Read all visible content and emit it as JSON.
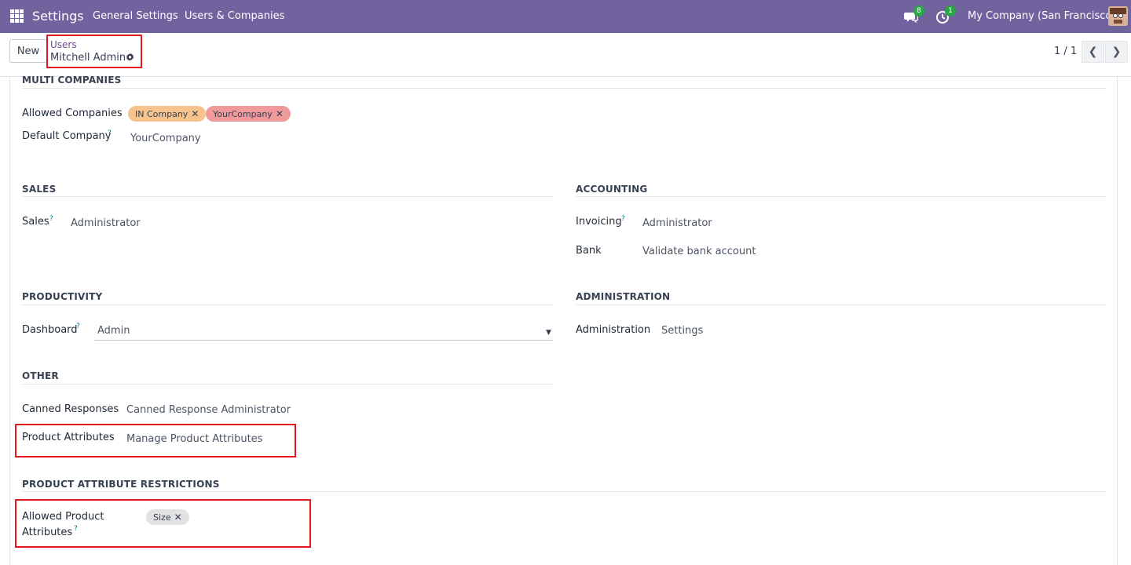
{
  "navbar": {
    "brand": "Settings",
    "menu": [
      "General Settings",
      "Users & Companies"
    ],
    "chat_count": "8",
    "activity_count": "1",
    "company": "My Company (San Francisco)",
    "color": "#71639e"
  },
  "control_panel": {
    "new_label": "New",
    "breadcrumb_parent": "Users",
    "breadcrumb_current": "Mitchell Admin",
    "pager": "1 / 1"
  },
  "form": {
    "multi_companies": {
      "title": "MULTI COMPANIES",
      "allowed_companies_label": "Allowed Companies",
      "allowed_companies_tags": [
        "IN Company",
        "YourCompany"
      ],
      "default_company_label": "Default Company",
      "default_company_value": "YourCompany"
    },
    "sales": {
      "title": "SALES",
      "sales_label": "Sales",
      "sales_value": "Administrator"
    },
    "accounting": {
      "title": "ACCOUNTING",
      "invoicing_label": "Invoicing",
      "invoicing_value": "Administrator",
      "bank_label": "Bank",
      "bank_value": "Validate bank account"
    },
    "productivity": {
      "title": "PRODUCTIVITY",
      "dashboard_label": "Dashboard",
      "dashboard_value": "Admin"
    },
    "administration": {
      "title": "ADMINISTRATION",
      "administration_label": "Administration",
      "administration_value": "Settings"
    },
    "other": {
      "title": "OTHER",
      "canned_label": "Canned Responses",
      "canned_value": "Canned Response Administrator",
      "product_attr_label": "Product Attributes",
      "product_attr_value": "Manage Product Attributes"
    },
    "restrictions": {
      "title": "PRODUCT ATTRIBUTE RESTRICTIONS",
      "allowed_label_line1": "Allowed Product",
      "allowed_label_line2": "Attributes",
      "allowed_tags": [
        "Size"
      ]
    },
    "help_mark": "?",
    "remove_mark": "✕"
  },
  "colors": {
    "highlight": "#e3161e",
    "tag_in_company": "#f6c38f",
    "tag_yourcompany": "#f09a9b",
    "tag_size": "#e2e2e2"
  }
}
